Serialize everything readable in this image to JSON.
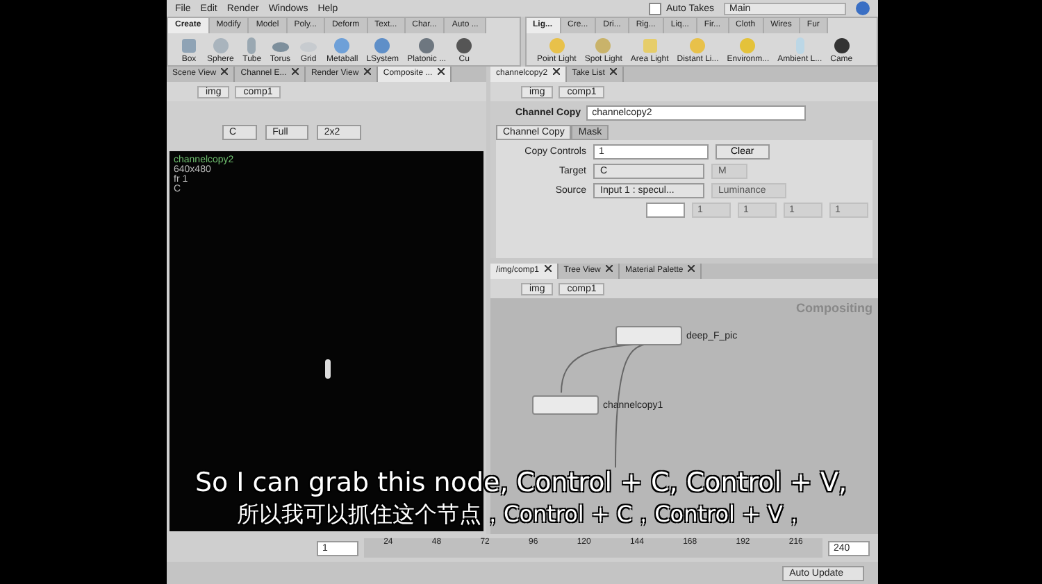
{
  "menu": [
    "File",
    "Edit",
    "Render",
    "Windows",
    "Help"
  ],
  "auto_takes": {
    "label": "Auto Takes",
    "checked": false
  },
  "take": {
    "value": "Main"
  },
  "shelf_left": {
    "tabs": [
      {
        "label": "Create",
        "selected": true
      },
      {
        "label": "Modify",
        "selected": false
      },
      {
        "label": "Model",
        "selected": false
      },
      {
        "label": "Poly...",
        "selected": false
      },
      {
        "label": "Deform",
        "selected": false
      },
      {
        "label": "Text...",
        "selected": false
      },
      {
        "label": "Char...",
        "selected": false
      },
      {
        "label": "Auto ...",
        "selected": false
      }
    ],
    "tools": [
      {
        "label": "Box",
        "kind": "cube"
      },
      {
        "label": "Sphere",
        "kind": "sphere"
      },
      {
        "label": "Tube",
        "kind": "tube"
      },
      {
        "label": "Torus",
        "kind": "torus"
      },
      {
        "label": "Grid",
        "kind": "grid"
      },
      {
        "label": "Metaball",
        "kind": "metaball"
      },
      {
        "label": "LSystem",
        "kind": "tree"
      },
      {
        "label": "Platonic ...",
        "kind": "platonic"
      },
      {
        "label": "Cu",
        "kind": "curve"
      }
    ]
  },
  "shelf_right": {
    "tabs": [
      {
        "label": "Lig...",
        "selected": true
      },
      {
        "label": "Cre...",
        "selected": false
      },
      {
        "label": "Dri...",
        "selected": false
      },
      {
        "label": "Rig...",
        "selected": false
      },
      {
        "label": "Liq...",
        "selected": false
      },
      {
        "label": "Fir...",
        "selected": false
      },
      {
        "label": "Cloth",
        "selected": false
      },
      {
        "label": "Wires",
        "selected": false
      },
      {
        "label": "Fur",
        "selected": false
      }
    ],
    "tools": [
      {
        "label": "Point Light",
        "kind": "sun"
      },
      {
        "label": "Spot Light",
        "kind": "spot"
      },
      {
        "label": "Area Light",
        "kind": "area"
      },
      {
        "label": "Distant Li...",
        "kind": "sun"
      },
      {
        "label": "Environm...",
        "kind": "eye"
      },
      {
        "label": "Ambient L...",
        "kind": "bulb"
      },
      {
        "label": "Came",
        "kind": "camera"
      }
    ]
  },
  "left_pane": {
    "tabs": [
      {
        "label": "Scene View",
        "selected": false
      },
      {
        "label": "Channel E...",
        "selected": false
      },
      {
        "label": "Render View",
        "selected": false
      },
      {
        "label": "Composite ...",
        "selected": true
      }
    ],
    "path": [
      "img",
      "comp1"
    ],
    "toolbar": [
      "C",
      "Full",
      "2x2"
    ],
    "viewer": {
      "title": "channelcopy2",
      "lines": [
        "640x480",
        "fr 1",
        "C"
      ]
    }
  },
  "param_pane": {
    "tabs": [
      {
        "label": "channelcopy2",
        "selected": true
      },
      {
        "label": "Take List",
        "selected": false
      }
    ],
    "path": [
      "img",
      "comp1"
    ],
    "node_type": "Channel Copy",
    "node_name": "channelcopy2",
    "param_tabs": [
      {
        "label": "Channel Copy",
        "selected": true
      },
      {
        "label": "Mask",
        "selected": false
      }
    ],
    "copy_controls": {
      "label": "Copy Controls",
      "value": "1",
      "clear": "Clear"
    },
    "target": {
      "label": "Target",
      "value": "C",
      "extra": "M"
    },
    "source": {
      "label": "Source",
      "value": "Input 1 : specul...",
      "extra": "Luminance"
    },
    "components": [
      "1",
      "1",
      "1",
      "1"
    ]
  },
  "network_pane": {
    "tabs": [
      {
        "label": "/img/comp1",
        "selected": true
      },
      {
        "label": "Tree View",
        "selected": false
      },
      {
        "label": "Material Palette",
        "selected": false
      }
    ],
    "path": [
      "img",
      "comp1"
    ],
    "context": "Compositing",
    "nodes": [
      {
        "name": "deep_F_pic"
      },
      {
        "name": "channelcopy1"
      }
    ]
  },
  "timeline": {
    "frame": "1",
    "ticks": [
      "24",
      "48",
      "72",
      "96",
      "120",
      "144",
      "168",
      "192",
      "216"
    ],
    "end": "240"
  },
  "status": {
    "update": "Auto Update"
  },
  "subtitles": [
    "So I can grab this node, Control + C, Control + V,",
    "所以我可以抓住这个节点，Control + C，Control + V，"
  ]
}
